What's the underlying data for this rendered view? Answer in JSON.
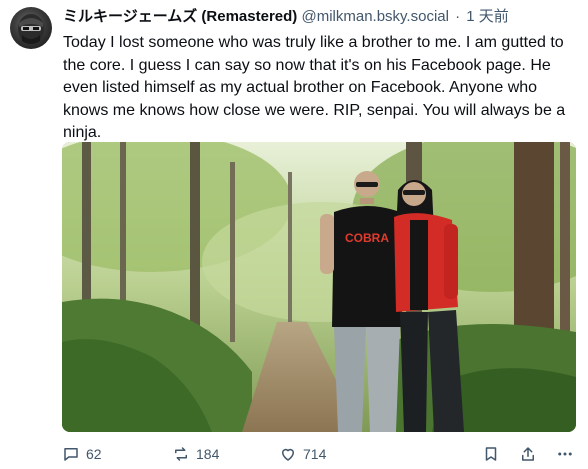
{
  "post": {
    "display_name": "ミルキージェームズ (Remastered)",
    "handle": "@milkman.bsky.social",
    "separator": "·",
    "time": "1 天前",
    "text": "Today I lost someone who was truly like a brother to me. I am gutted to the core. I guess I can say so now that it's on his Facebook page. He even listed himself as my actual brother on Facebook. Anyone who knows me knows how close we were. RIP, senpai. You will always be a ninja.",
    "image": {
      "shirt_text": "COBRA"
    }
  },
  "actions": {
    "reply_count": "62",
    "repost_count": "184",
    "like_count": "714"
  },
  "icons": {
    "reply": "reply-icon",
    "repost": "repost-icon",
    "like": "heart-icon",
    "bookmark": "bookmark-icon",
    "share": "share-icon",
    "more": "more-icon"
  },
  "colors": {
    "text": "#0b0f14",
    "muted": "#42576c"
  }
}
